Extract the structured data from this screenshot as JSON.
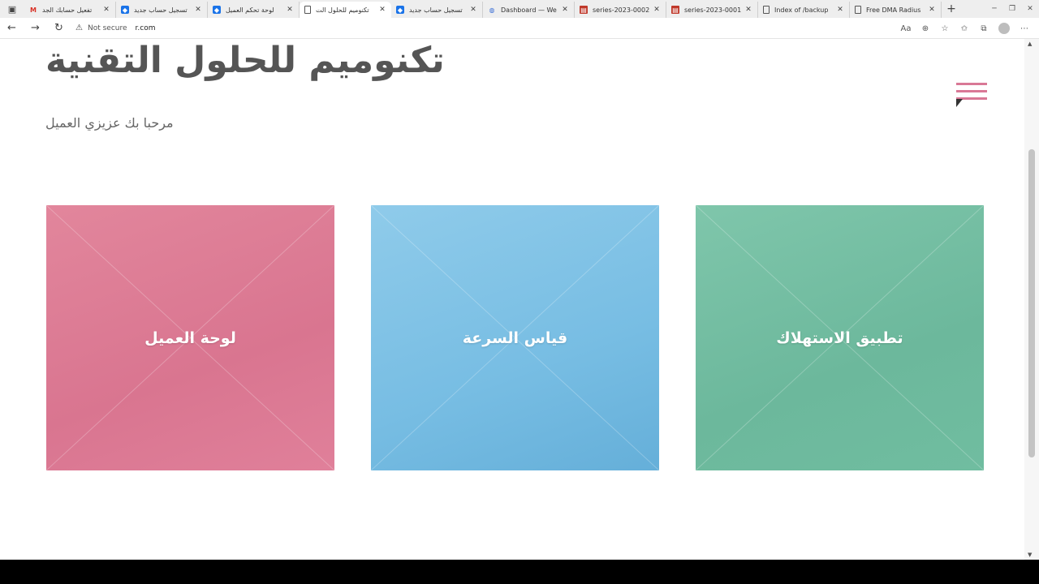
{
  "browser": {
    "tabs": [
      {
        "title": "تفعيل حسابك الجد",
        "icon": "gmail-icon"
      },
      {
        "title": "تسجيل حساب جديد",
        "icon": "shield-icon"
      },
      {
        "title": "لوحة تحكم العميل",
        "icon": "shield-icon"
      },
      {
        "title": "تكنوميم للحلول الت",
        "icon": "document-icon",
        "active": true
      },
      {
        "title": "تسجيل حساب جديد",
        "icon": "shield-icon"
      },
      {
        "title": "Dashboard — We",
        "icon": "globe-icon"
      },
      {
        "title": "series-2023-0002",
        "icon": "pdf-icon"
      },
      {
        "title": "series-2023-0001",
        "icon": "pdf-icon"
      },
      {
        "title": "Index of /backup",
        "icon": "document-icon"
      },
      {
        "title": "Free DMA Radius",
        "icon": "document-icon"
      }
    ],
    "address": {
      "security_label": "Not secure",
      "url": "r.com"
    }
  },
  "page": {
    "site_title": "تكنوميم للحلول التقنية",
    "welcome_text": "مرحبا بك عزيزي العميل",
    "cards": [
      {
        "label": "لوحة العميل",
        "color": "#db7a93"
      },
      {
        "label": "قياس السرعة",
        "color": "#78bfe4"
      },
      {
        "label": "تطبيق الاستهلاك",
        "color": "#72bca0"
      }
    ],
    "menu_color": "#d97896"
  }
}
